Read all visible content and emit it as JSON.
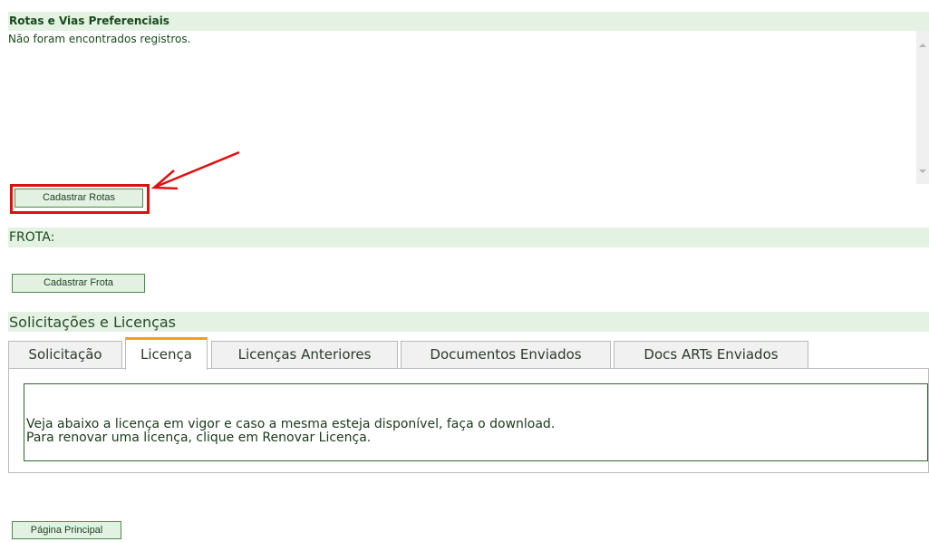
{
  "rotas": {
    "title": "Rotas e Vias Preferenciais",
    "empty_message": "Não foram encontrados registros.",
    "button_label": "Cadastrar Rotas"
  },
  "frota": {
    "title": "FROTA:",
    "button_label": "Cadastrar Frota"
  },
  "solicitacoes": {
    "title": "Solicitações e Licenças",
    "tabs": [
      {
        "label": "Solicitação"
      },
      {
        "label": "Licença"
      },
      {
        "label": "Licenças Anteriores"
      },
      {
        "label": "Documentos Enviados"
      },
      {
        "label": "Docs ARTs Enviados"
      }
    ],
    "active_tab": 1,
    "info_line_1": "Veja abaixo a licença em vigor e caso a mesma esteja disponível, faça o download.",
    "info_line_2": "Para renovar uma licença, clique em Renovar Licença."
  },
  "footer": {
    "main_page_button": "Página Principal"
  },
  "colors": {
    "header_bg": "#e3f2e3",
    "button_bg": "#e2f1e2",
    "button_border": "#4d8a4d",
    "highlight": "#e01010",
    "active_tab_accent": "#f0a020"
  }
}
